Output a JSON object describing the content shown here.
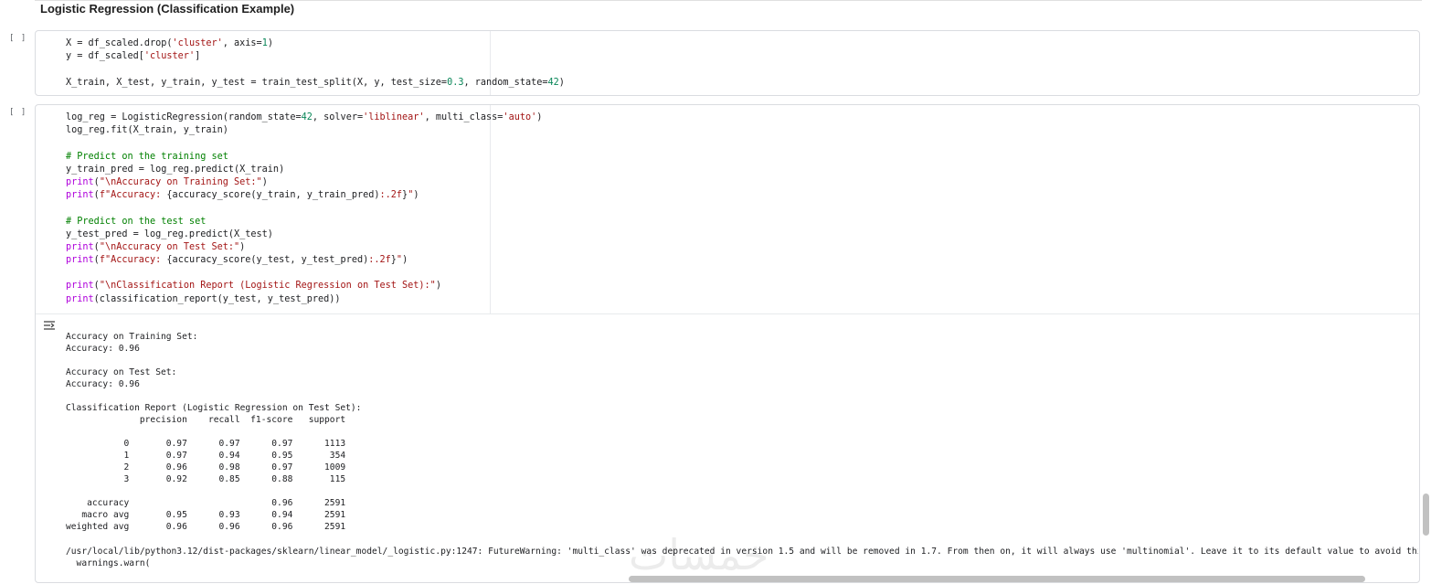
{
  "section": {
    "heading": "Logistic Regression (Classification Example)"
  },
  "cells": [
    {
      "run_indicator": "[ ]",
      "code": [
        [
          {
            "t": "X = df_scaled.drop("
          },
          {
            "t": "'cluster'",
            "c": "str"
          },
          {
            "t": ", axis="
          },
          {
            "t": "1",
            "c": "num"
          },
          {
            "t": ")"
          }
        ],
        [
          {
            "t": "y = df_scaled["
          },
          {
            "t": "'cluster'",
            "c": "str"
          },
          {
            "t": "]"
          }
        ],
        [
          {
            "t": ""
          }
        ],
        [
          {
            "t": "X_train, X_test, y_train, y_test = train_test_split(X, y, test_size="
          },
          {
            "t": "0.3",
            "c": "num"
          },
          {
            "t": ", random_state="
          },
          {
            "t": "42",
            "c": "num"
          },
          {
            "t": ")"
          }
        ]
      ]
    },
    {
      "run_indicator": "[ ]",
      "code": [
        [
          {
            "t": "log_reg = LogisticRegression(random_state="
          },
          {
            "t": "42",
            "c": "num"
          },
          {
            "t": ", solver="
          },
          {
            "t": "'liblinear'",
            "c": "str"
          },
          {
            "t": ", multi_class="
          },
          {
            "t": "'auto'",
            "c": "str"
          },
          {
            "t": ")"
          }
        ],
        [
          {
            "t": "log_reg.fit(X_train, y_train)"
          }
        ],
        [
          {
            "t": ""
          }
        ],
        [
          {
            "t": "# Predict on the training set",
            "c": "com"
          }
        ],
        [
          {
            "t": "y_train_pred = log_reg.predict(X_train)"
          }
        ],
        [
          {
            "t": "print",
            "c": "print"
          },
          {
            "t": "("
          },
          {
            "t": "\"\\nAccuracy on Training Set:\"",
            "c": "str"
          },
          {
            "t": ")"
          }
        ],
        [
          {
            "t": "print",
            "c": "print"
          },
          {
            "t": "("
          },
          {
            "t": "f\"Accuracy: ",
            "c": "str"
          },
          {
            "t": "{accuracy_score(y_train, y_train_pred)"
          },
          {
            "t": ":.2f",
            "c": "str"
          },
          {
            "t": "}"
          },
          {
            "t": "\"",
            "c": "str"
          },
          {
            "t": ")"
          }
        ],
        [
          {
            "t": ""
          }
        ],
        [
          {
            "t": "# Predict on the test set",
            "c": "com"
          }
        ],
        [
          {
            "t": "y_test_pred = log_reg.predict(X_test)"
          }
        ],
        [
          {
            "t": "print",
            "c": "print"
          },
          {
            "t": "("
          },
          {
            "t": "\"\\nAccuracy on Test Set:\"",
            "c": "str"
          },
          {
            "t": ")"
          }
        ],
        [
          {
            "t": "print",
            "c": "print"
          },
          {
            "t": "("
          },
          {
            "t": "f\"Accuracy: ",
            "c": "str"
          },
          {
            "t": "{accuracy_score(y_test, y_test_pred)"
          },
          {
            "t": ":.2f",
            "c": "str"
          },
          {
            "t": "}"
          },
          {
            "t": "\"",
            "c": "str"
          },
          {
            "t": ")"
          }
        ],
        [
          {
            "t": ""
          }
        ],
        [
          {
            "t": "print",
            "c": "print"
          },
          {
            "t": "("
          },
          {
            "t": "\"\\nClassification Report (Logistic Regression on Test Set):\"",
            "c": "str"
          },
          {
            "t": ")"
          }
        ],
        [
          {
            "t": "print",
            "c": "print"
          },
          {
            "t": "(classification_report(y_test, y_test_pred))"
          }
        ]
      ],
      "output": {
        "text": "Accuracy on Training Set:\nAccuracy: 0.96\n\nAccuracy on Test Set:\nAccuracy: 0.96\n\nClassification Report (Logistic Regression on Test Set):\n              precision    recall  f1-score   support\n\n           0       0.97      0.97      0.97      1113\n           1       0.97      0.94      0.95       354\n           2       0.96      0.98      0.97      1009\n           3       0.92      0.85      0.88       115\n\n    accuracy                           0.96      2591\n   macro avg       0.95      0.93      0.94      2591\nweighted avg       0.96      0.96      0.96      2591\n",
        "warning": "/usr/local/lib/python3.12/dist-packages/sklearn/linear_model/_logistic.py:1247: FutureWarning: 'multi_class' was deprecated in version 1.5 and will be removed in 1.7. From then on, it will always use 'multinomial'. Leave it to its default value to avoid this warning.",
        "warning_line2": "  warnings.warn("
      }
    }
  ],
  "watermark": "خمسات",
  "colors": {
    "string": "#a31515",
    "number": "#098658",
    "comment": "#008000",
    "print": "#af00db"
  },
  "icons": {
    "output_toggle": "output-toggle-icon"
  }
}
